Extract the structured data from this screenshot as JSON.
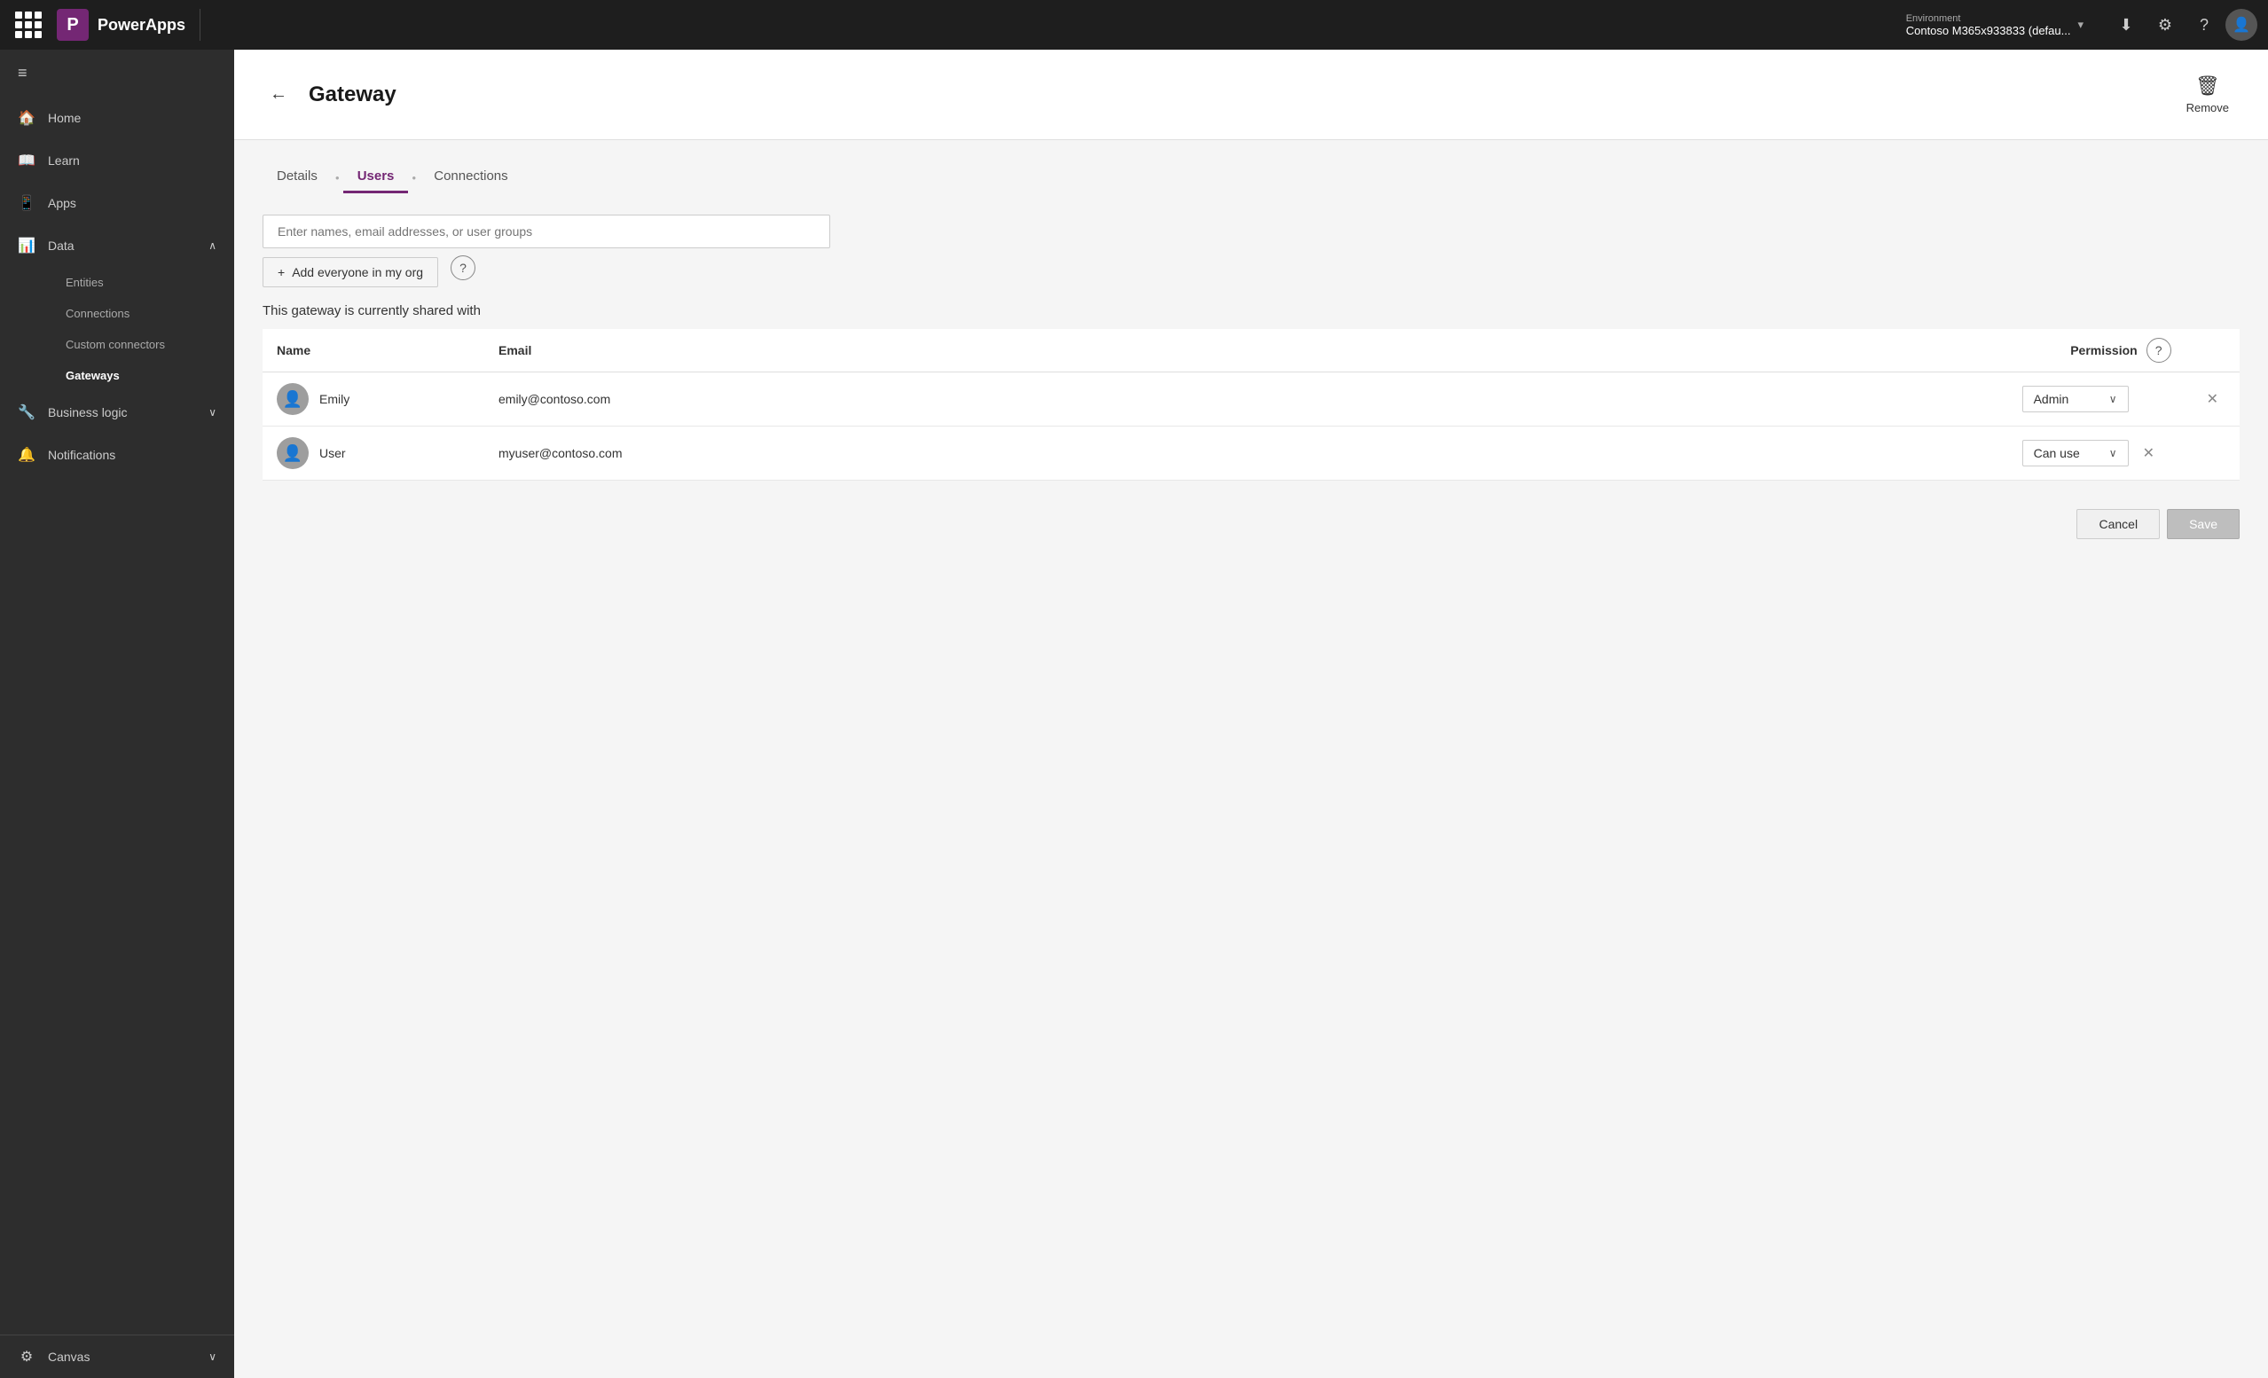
{
  "topNav": {
    "brandName": "PowerApps",
    "environment": {
      "label": "Environment",
      "name": "Contoso M365x933833 (defau..."
    },
    "actions": {
      "download": "⬇",
      "settings": "⚙",
      "help": "?",
      "avatar": "👤"
    }
  },
  "sidebar": {
    "menuIcon": "≡",
    "items": [
      {
        "id": "home",
        "label": "Home",
        "icon": "🏠"
      },
      {
        "id": "learn",
        "label": "Learn",
        "icon": "📖"
      },
      {
        "id": "apps",
        "label": "Apps",
        "icon": "📱"
      },
      {
        "id": "data",
        "label": "Data",
        "icon": "📊",
        "hasChevron": true,
        "expanded": true
      },
      {
        "id": "business-logic",
        "label": "Business logic",
        "icon": "🔧",
        "hasChevron": true
      },
      {
        "id": "notifications",
        "label": "Notifications",
        "icon": "🔔"
      }
    ],
    "dataSubItems": [
      {
        "id": "entities",
        "label": "Entities"
      },
      {
        "id": "connections",
        "label": "Connections"
      },
      {
        "id": "custom-connectors",
        "label": "Custom connectors"
      },
      {
        "id": "gateways",
        "label": "Gateways",
        "active": true
      }
    ],
    "bottomItems": [
      {
        "id": "canvas",
        "label": "Canvas",
        "hasChevron": true
      }
    ]
  },
  "page": {
    "title": "Gateway",
    "removeLabel": "Remove"
  },
  "tabs": [
    {
      "id": "details",
      "label": "Details",
      "active": false
    },
    {
      "id": "users",
      "label": "Users",
      "active": true
    },
    {
      "id": "connections",
      "label": "Connections",
      "active": false
    }
  ],
  "users": {
    "searchPlaceholder": "Enter names, email addresses, or user groups",
    "addEveryoneLabel": "Add everyone in my org",
    "sharedLabel": "This gateway is currently shared with",
    "columns": {
      "name": "Name",
      "email": "Email",
      "permission": "Permission"
    },
    "rows": [
      {
        "id": "emily",
        "name": "Emily",
        "email": "emily@contoso.com",
        "permission": "Admin"
      },
      {
        "id": "user",
        "name": "User",
        "email": "myuser@contoso.com",
        "permission": "Can use"
      }
    ]
  },
  "footer": {
    "cancelLabel": "Cancel",
    "saveLabel": "Save"
  }
}
